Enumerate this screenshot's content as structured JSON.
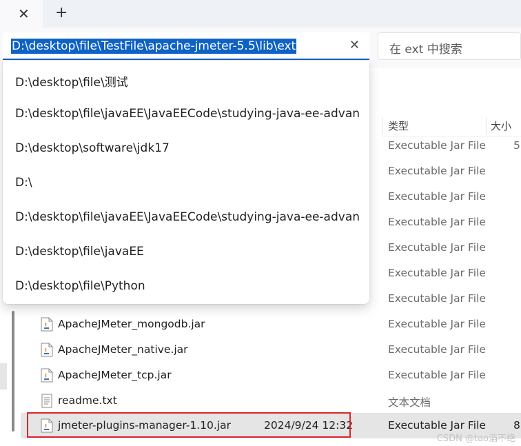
{
  "address_bar": {
    "path": "D:\\desktop\\file\\TestFile\\apache-jmeter-5.5\\lib\\ext",
    "clear_icon": "close-icon"
  },
  "search": {
    "placeholder": "在 ext 中搜索"
  },
  "tabs": {
    "close_icon": "close-icon",
    "new_tab_icon": "plus-icon"
  },
  "dropdown": {
    "items": [
      "D:\\desktop\\file\\测试",
      "D:\\desktop\\file\\javaEE\\JavaEECode\\studying-java-ee-advanced\\sp",
      "D:\\desktop\\software\\jdk17",
      "D:\\",
      "D:\\desktop\\file\\javaEE\\JavaEECode\\studying-java-ee-advanced\\sp",
      "D:\\desktop\\file\\javaEE",
      "D:\\desktop\\file\\Python"
    ]
  },
  "columns": {
    "type": "类型",
    "size": "大小"
  },
  "hidden_rows": [
    {
      "type": "Executable Jar File",
      "size": "5"
    },
    {
      "type": "Executable Jar File",
      "size": ""
    },
    {
      "type": "Executable Jar File",
      "size": ""
    },
    {
      "type": "Executable Jar File",
      "size": ""
    },
    {
      "type": "Executable Jar File",
      "size": ""
    },
    {
      "type": "Executable Jar File",
      "size": ""
    },
    {
      "type": "Executable Jar File",
      "size": ""
    }
  ],
  "files": [
    {
      "name": "ApacheJMeter_mongodb.jar",
      "date": "",
      "type": "Executable Jar File",
      "size": "",
      "icon": "jar-file-icon"
    },
    {
      "name": "ApacheJMeter_native.jar",
      "date": "",
      "type": "Executable Jar File",
      "size": "",
      "icon": "jar-file-icon"
    },
    {
      "name": "ApacheJMeter_tcp.jar",
      "date": "",
      "type": "Executable Jar File",
      "size": "",
      "icon": "jar-file-icon"
    },
    {
      "name": "readme.txt",
      "date": "",
      "type": "文本文档",
      "size": "",
      "icon": "text-file-icon"
    },
    {
      "name": "jmeter-plugins-manager-1.10.jar",
      "date": "2024/9/24 12:32",
      "type": "Executable Jar File",
      "size": "8",
      "icon": "jar-file-icon"
    }
  ],
  "watermark": "CSDN @tao滔不绝"
}
